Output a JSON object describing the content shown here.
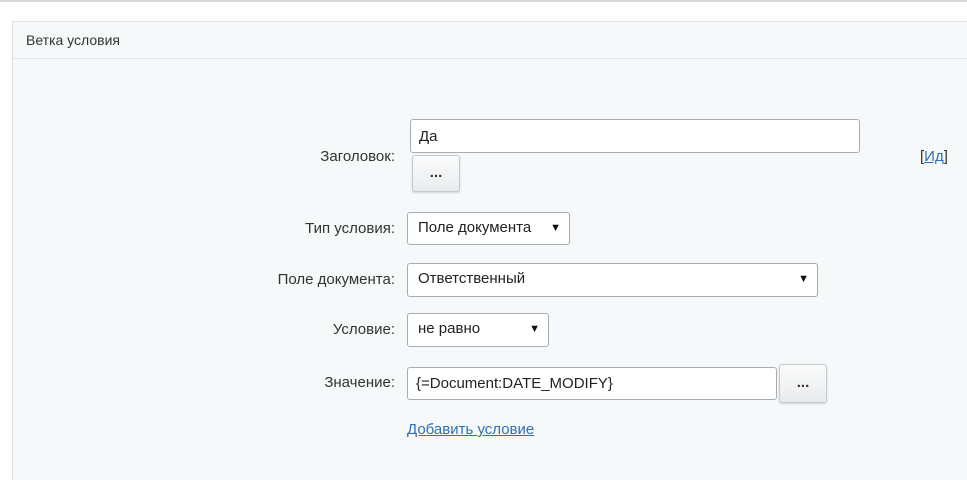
{
  "panel": {
    "title": "Ветка условия"
  },
  "form": {
    "title_label": "Заголовок:",
    "title_value": "Да",
    "title_button": "...",
    "id_bracket_open": "[",
    "id_link": "Ид",
    "id_bracket_close": "]",
    "condition_type_label": "Тип условия:",
    "condition_type_value": "Поле документа",
    "document_field_label": "Поле документа:",
    "document_field_value": "Ответственный",
    "condition_label": "Условие:",
    "condition_value": "не равно",
    "value_label": "Значение:",
    "value_value": "{=Document:DATE_MODIFY}",
    "value_button": "...",
    "add_condition_link": "Добавить условие"
  },
  "icons": {
    "caret": "triangle-down-icon"
  }
}
